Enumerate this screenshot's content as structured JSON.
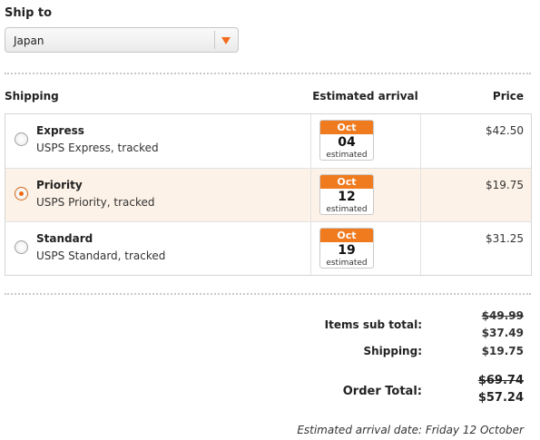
{
  "ship_to": {
    "label": "Ship to",
    "selected": "Japan"
  },
  "shipping_table": {
    "headers": {
      "shipping": "Shipping",
      "arrival": "Estimated arrival",
      "price": "Price"
    },
    "options": [
      {
        "name": "Express",
        "desc": "USPS Express, tracked",
        "month": "Oct",
        "day": "04",
        "est": "estimated",
        "price": "$42.50",
        "selected": false
      },
      {
        "name": "Priority",
        "desc": "USPS Priority, tracked",
        "month": "Oct",
        "day": "12",
        "est": "estimated",
        "price": "$19.75",
        "selected": true
      },
      {
        "name": "Standard",
        "desc": "USPS Standard, tracked",
        "month": "Oct",
        "day": "19",
        "est": "estimated",
        "price": "$31.25",
        "selected": false
      }
    ]
  },
  "summary": {
    "items_label": "Items sub total:",
    "items_old": "$49.99",
    "items_new": "$37.49",
    "shipping_label": "Shipping:",
    "shipping_value": "$19.75",
    "total_label": "Order Total:",
    "total_old": "$69.74",
    "total_new": "$57.24",
    "estimated_arrival": "Estimated arrival date: Friday 12 October"
  },
  "colors": {
    "accent": "#f07a1e",
    "selected_row": "#fdf2e7"
  }
}
